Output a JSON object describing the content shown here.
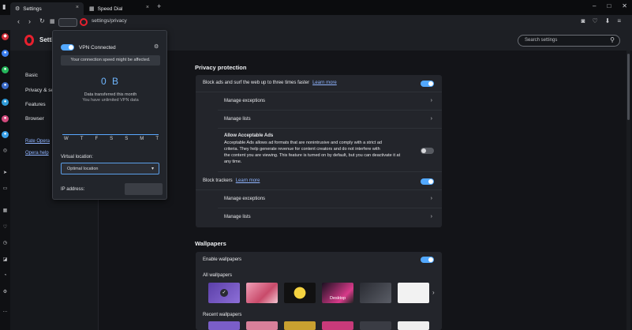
{
  "tabs": [
    {
      "label": "Settings",
      "close": "×"
    },
    {
      "label": "Speed Dial",
      "close": "×"
    }
  ],
  "tab_plus": "+",
  "window_controls": {
    "minimize": "–",
    "maximize": "□",
    "close": "✕"
  },
  "address": {
    "url": "settings/privacy"
  },
  "settings": {
    "title": "Setti",
    "search_placeholder": "Search settings",
    "nav": {
      "basic": "Basic",
      "privacy": "Privacy & se",
      "features": "Features",
      "browser": "Browser",
      "rate_opera": "Rate Opera",
      "opera_help": "Opera help"
    }
  },
  "privacy": {
    "section_title": "Privacy protection",
    "block_ads": "Block ads and surf the web up to three times faster",
    "learn_more": "Learn more",
    "manage_exceptions": "Manage exceptions",
    "manage_lists": "Manage lists",
    "acceptable_ads_title": "Allow Acceptable Ads",
    "acceptable_ads_desc_1": "Acceptable Ads allows ad formats that are nonintrusive and comply with a strict ad",
    "acceptable_ads_desc_2": "criteria. They help generate revenue for content creators and do not interfere with",
    "acceptable_ads_desc_3": "the content you are viewing. This feature is turned on by default, but you can deactivate it at",
    "acceptable_ads_desc_4": "any time.",
    "block_trackers": "Block trackers",
    "manage_exceptions_2": "Manage exceptions",
    "manage_lists_2": "Manage lists"
  },
  "wallpapers": {
    "section_title": "Wallpapers",
    "enable": "Enable wallpapers",
    "all": "All wallpapers",
    "recent": "Recent wallpapers",
    "desktop_label": "Desktop"
  },
  "vpn": {
    "status": "VPN Connected",
    "warning": "Your connection speed might be affected.",
    "data_amount": "0 B",
    "data_caption": "Data transferred this month",
    "unlimited": "You have unlimited VPN data",
    "days": [
      "W",
      "T",
      "F",
      "S",
      "S",
      "M",
      "T"
    ],
    "virtual_location_label": "Virtual location:",
    "location_value": "Optimal location",
    "ip_label": "IP address:"
  },
  "colors": {
    "accent": "#52a8ff",
    "opera_red": "#e8202e",
    "background": "#131418",
    "card": "#23252b"
  }
}
